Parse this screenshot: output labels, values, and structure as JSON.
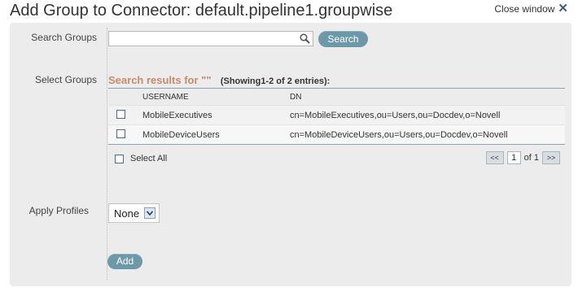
{
  "window": {
    "title": "Add Group to Connector: default.pipeline1.groupwise",
    "close_label": "Close window"
  },
  "search": {
    "label": "Search Groups",
    "value": "",
    "button_label": "Search"
  },
  "results": {
    "label": "Select Groups",
    "title": "Search results for \"\"",
    "count_text": "(Showing1-2 of 2 entries):",
    "columns": [
      "USERNAME",
      "DN"
    ],
    "rows": [
      {
        "username": "MobileExecutives",
        "dn": "cn=MobileExecutives,ou=Users,ou=Docdev,o=Novell",
        "checked": false
      },
      {
        "username": "MobileDeviceUsers",
        "dn": "cn=MobileDeviceUsers,ou=Users,ou=Docdev,o=Novell",
        "checked": false
      }
    ],
    "select_all_label": "Select All",
    "pager": {
      "prev": "<<",
      "page": "1",
      "of_text": "of 1",
      "next": ">>"
    }
  },
  "profiles": {
    "label": "Apply Profiles",
    "selected": "None"
  },
  "actions": {
    "add_label": "Add"
  },
  "colors": {
    "accent": "#6c98a8",
    "results_title": "#c98a6c",
    "panel_bg": "#ececec"
  },
  "icons": [
    "close-icon",
    "search-icon",
    "chevron-down-icon"
  ]
}
